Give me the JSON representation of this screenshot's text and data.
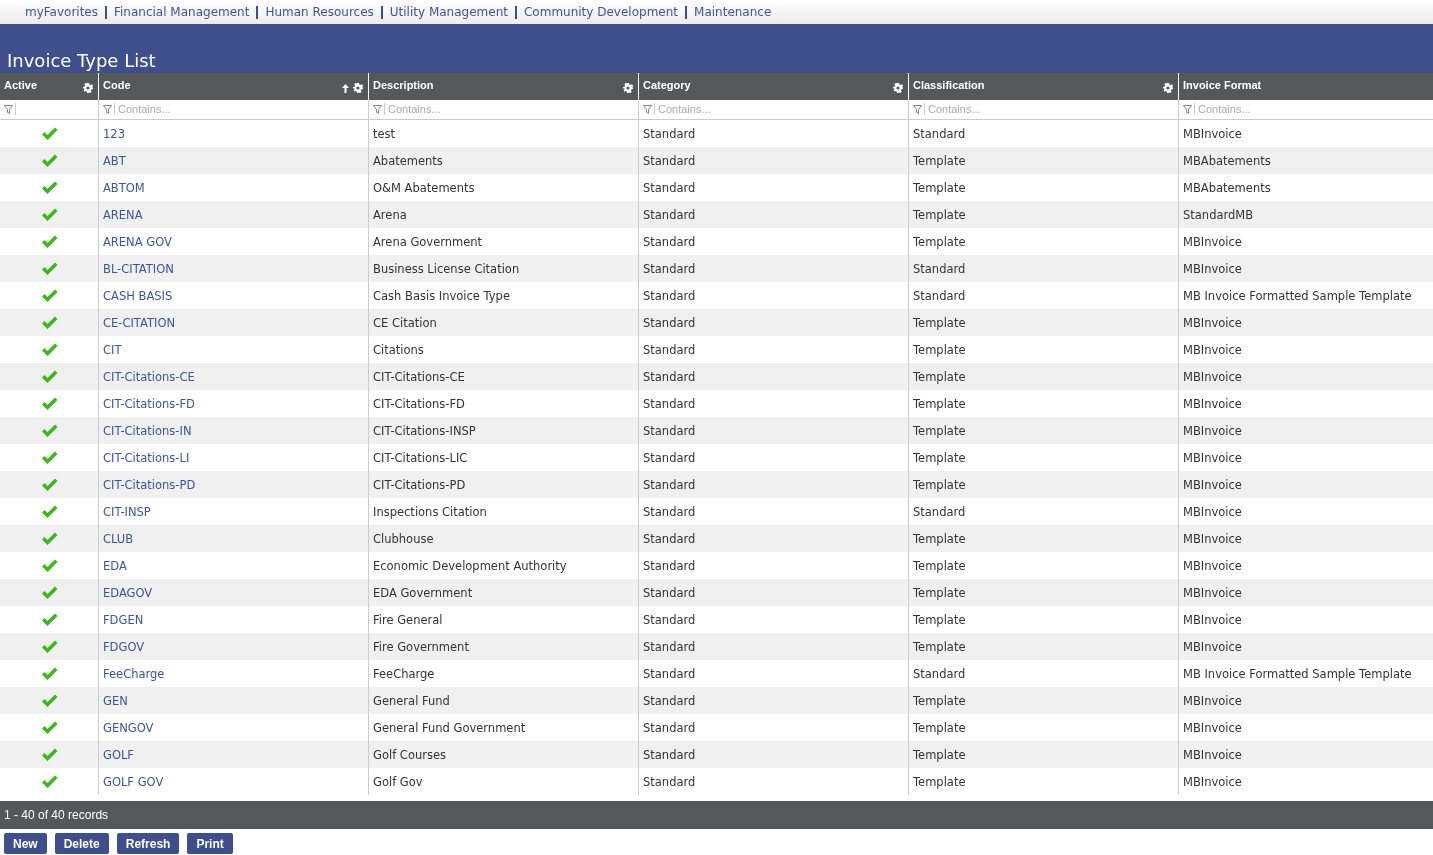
{
  "nav": [
    "myFavorites",
    "Financial Management",
    "Human Resources",
    "Utility Management",
    "Community Development",
    "Maintenance"
  ],
  "title": "Invoice Type List",
  "columns": [
    {
      "label": "Active",
      "sorted": false,
      "menu": true
    },
    {
      "label": "Code",
      "sorted": true,
      "menu": true,
      "placeholder": "Contains..."
    },
    {
      "label": "Description",
      "sorted": false,
      "menu": true,
      "placeholder": "Contains..."
    },
    {
      "label": "Category",
      "sorted": false,
      "menu": true,
      "placeholder": "Contains..."
    },
    {
      "label": "Classification",
      "sorted": false,
      "menu": true,
      "placeholder": "Contains..."
    },
    {
      "label": "Invoice Format",
      "sorted": false,
      "menu": false,
      "placeholder": "Contains..."
    }
  ],
  "rows": [
    {
      "active": true,
      "code": "123",
      "description": "test",
      "category": "Standard",
      "classification": "Standard",
      "format": "MBInvoice"
    },
    {
      "active": true,
      "code": "ABT",
      "description": "Abatements",
      "category": "Standard",
      "classification": "Template",
      "format": "MBAbatements"
    },
    {
      "active": true,
      "code": "ABTOM",
      "description": "O&M Abatements",
      "category": "Standard",
      "classification": "Template",
      "format": "MBAbatements"
    },
    {
      "active": true,
      "code": "ARENA",
      "description": "Arena",
      "category": "Standard",
      "classification": "Template",
      "format": "StandardMB"
    },
    {
      "active": true,
      "code": "ARENA GOV",
      "description": "Arena Government",
      "category": "Standard",
      "classification": "Template",
      "format": "MBInvoice"
    },
    {
      "active": true,
      "code": "BL-CITATION",
      "description": "Business License Citation",
      "category": "Standard",
      "classification": "Standard",
      "format": "MBInvoice"
    },
    {
      "active": true,
      "code": "CASH BASIS",
      "description": "Cash Basis Invoice Type",
      "category": "Standard",
      "classification": "Standard",
      "format": "MB Invoice Formatted Sample Template"
    },
    {
      "active": true,
      "code": "CE-CITATION",
      "description": "CE Citation",
      "category": "Standard",
      "classification": "Template",
      "format": "MBInvoice"
    },
    {
      "active": true,
      "code": "CIT",
      "description": "Citations",
      "category": "Standard",
      "classification": "Template",
      "format": "MBInvoice"
    },
    {
      "active": true,
      "code": "CIT-Citations-CE",
      "description": "CIT-Citations-CE",
      "category": "Standard",
      "classification": "Template",
      "format": "MBInvoice"
    },
    {
      "active": true,
      "code": "CIT-Citations-FD",
      "description": "CIT-Citations-FD",
      "category": "Standard",
      "classification": "Template",
      "format": "MBInvoice"
    },
    {
      "active": true,
      "code": "CIT-Citations-IN",
      "description": "CIT-Citations-INSP",
      "category": "Standard",
      "classification": "Template",
      "format": "MBInvoice"
    },
    {
      "active": true,
      "code": "CIT-Citations-LI",
      "description": "CIT-Citations-LIC",
      "category": "Standard",
      "classification": "Template",
      "format": "MBInvoice"
    },
    {
      "active": true,
      "code": "CIT-Citations-PD",
      "description": "CIT-Citations-PD",
      "category": "Standard",
      "classification": "Template",
      "format": "MBInvoice"
    },
    {
      "active": true,
      "code": "CIT-INSP",
      "description": "Inspections Citation",
      "category": "Standard",
      "classification": "Standard",
      "format": "MBInvoice"
    },
    {
      "active": true,
      "code": "CLUB",
      "description": "Clubhouse",
      "category": "Standard",
      "classification": "Template",
      "format": "MBInvoice"
    },
    {
      "active": true,
      "code": "EDA",
      "description": "Economic Development Authority",
      "category": "Standard",
      "classification": "Template",
      "format": "MBInvoice"
    },
    {
      "active": true,
      "code": "EDAGOV",
      "description": "EDA Government",
      "category": "Standard",
      "classification": "Template",
      "format": "MBInvoice"
    },
    {
      "active": true,
      "code": "FDGEN",
      "description": "Fire General",
      "category": "Standard",
      "classification": "Template",
      "format": "MBInvoice"
    },
    {
      "active": true,
      "code": "FDGOV",
      "description": "Fire Government",
      "category": "Standard",
      "classification": "Template",
      "format": "MBInvoice"
    },
    {
      "active": true,
      "code": "FeeCharge",
      "description": "FeeCharge",
      "category": "Standard",
      "classification": "Standard",
      "format": "MB Invoice Formatted Sample Template"
    },
    {
      "active": true,
      "code": "GEN",
      "description": "General Fund",
      "category": "Standard",
      "classification": "Template",
      "format": "MBInvoice"
    },
    {
      "active": true,
      "code": "GENGOV",
      "description": "General Fund Government",
      "category": "Standard",
      "classification": "Template",
      "format": "MBInvoice"
    },
    {
      "active": true,
      "code": "GOLF",
      "description": "Golf Courses",
      "category": "Standard",
      "classification": "Template",
      "format": "MBInvoice"
    },
    {
      "active": true,
      "code": "GOLF GOV",
      "description": "Golf Gov",
      "category": "Standard",
      "classification": "Template",
      "format": "MBInvoice"
    }
  ],
  "status": "1 - 40 of 40 records",
  "buttons": [
    "New",
    "Delete",
    "Refresh",
    "Print"
  ]
}
